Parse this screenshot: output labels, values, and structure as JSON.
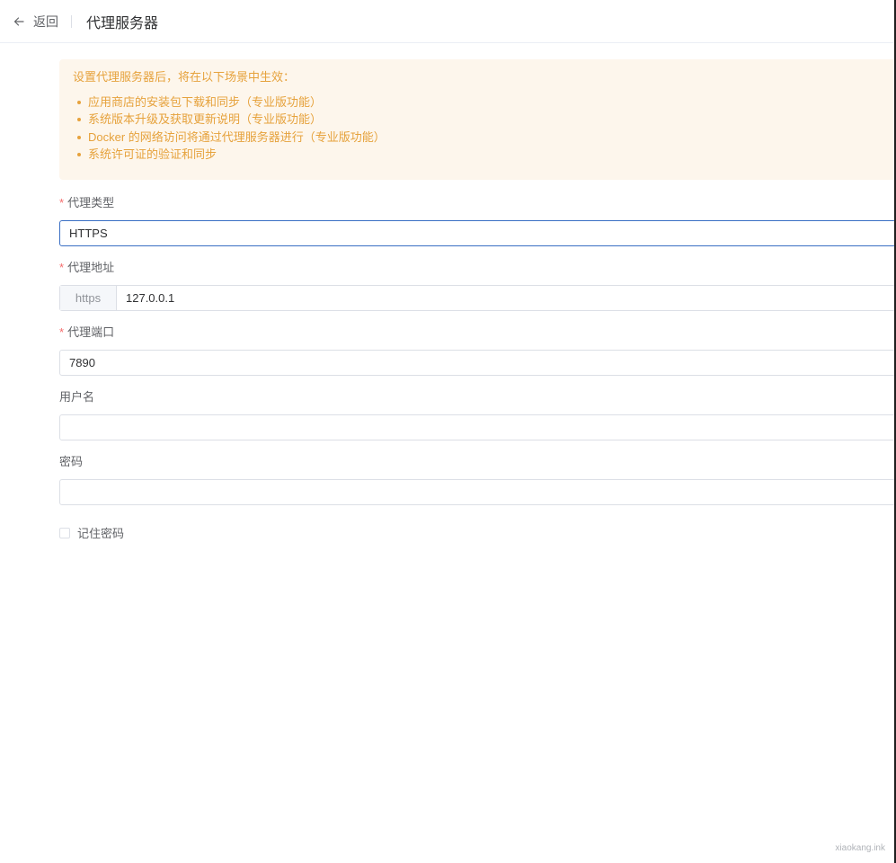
{
  "header": {
    "back_label": "返回",
    "title": "代理服务器"
  },
  "alert": {
    "title": "设置代理服务器后，将在以下场景中生效：",
    "items": [
      "应用商店的安装包下载和同步（专业版功能）",
      "系统版本升级及获取更新说明（专业版功能）",
      "Docker 的网络访问将通过代理服务器进行（专业版功能）",
      "系统许可证的验证和同步"
    ]
  },
  "form": {
    "required_mark": "*",
    "proxy_type": {
      "label": "代理类型",
      "value": "HTTPS"
    },
    "proxy_address": {
      "label": "代理地址",
      "prefix": "https",
      "value": "127.0.0.1"
    },
    "proxy_port": {
      "label": "代理端口",
      "value": "7890"
    },
    "username": {
      "label": "用户名",
      "value": ""
    },
    "password": {
      "label": "密码",
      "value": ""
    },
    "remember_password": {
      "label": "记住密码",
      "checked": false
    }
  },
  "watermark": "xiaokang.ink",
  "colors": {
    "alert_bg": "#fdf6ec",
    "alert_text": "#e6a23c",
    "required": "#f56c6c",
    "focus_border": "#3a6fc4"
  },
  "icons": {
    "back": "arrow-left-icon"
  }
}
